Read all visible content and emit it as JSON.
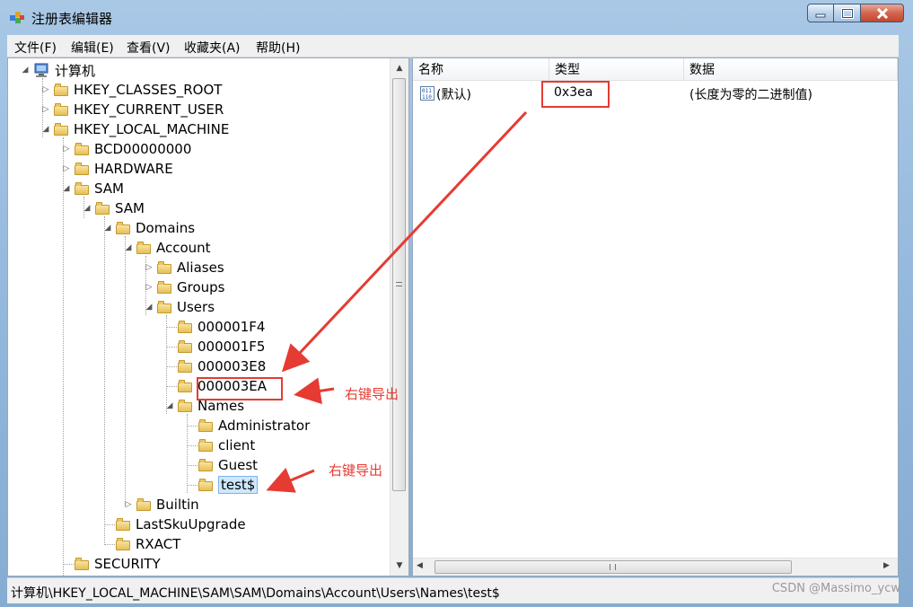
{
  "window": {
    "title": "注册表编辑器",
    "app_icon": "regedit-icon",
    "caption_buttons": [
      "minimize-icon",
      "maximize-icon",
      "close-icon"
    ]
  },
  "menu": [
    "文件(F)",
    "编辑(E)",
    "查看(V)",
    "收藏夹(A)",
    "帮助(H)"
  ],
  "tree": {
    "root": "计算机",
    "nodes": [
      {
        "label": "HKEY_CLASSES_ROOT",
        "expander": "collapsed"
      },
      {
        "label": "HKEY_CURRENT_USER",
        "expander": "collapsed"
      },
      {
        "label": "HKEY_LOCAL_MACHINE",
        "expander": "expanded"
      },
      {
        "label": "BCD00000000",
        "expander": "collapsed"
      },
      {
        "label": "HARDWARE",
        "expander": "collapsed"
      },
      {
        "label": "SAM",
        "expander": "expanded"
      },
      {
        "label": "SAM",
        "expander": "expanded"
      },
      {
        "label": "Domains",
        "expander": "expanded"
      },
      {
        "label": "Account",
        "expander": "expanded"
      },
      {
        "label": "Aliases",
        "expander": "collapsed"
      },
      {
        "label": "Groups",
        "expander": "collapsed"
      },
      {
        "label": "Users",
        "expander": "expanded"
      },
      {
        "label": "000001F4",
        "expander": "none"
      },
      {
        "label": "000001F5",
        "expander": "none"
      },
      {
        "label": "000003E8",
        "expander": "none"
      },
      {
        "label": "000003EA",
        "expander": "none"
      },
      {
        "label": "Names",
        "expander": "expanded"
      },
      {
        "label": "Administrator",
        "expander": "none"
      },
      {
        "label": "client",
        "expander": "none"
      },
      {
        "label": "Guest",
        "expander": "none"
      },
      {
        "label": "test$",
        "expander": "none",
        "selected": true
      },
      {
        "label": "Builtin",
        "expander": "collapsed"
      },
      {
        "label": "LastSkuUpgrade",
        "expander": "none"
      },
      {
        "label": "RXACT",
        "expander": "none"
      },
      {
        "label": "SECURITY",
        "expander": "none"
      }
    ]
  },
  "list": {
    "columns": [
      "名称",
      "类型",
      "数据"
    ],
    "rows": [
      {
        "name": "(默认)",
        "type": "0x3ea",
        "data": "(长度为零的二进制值)",
        "icon": "binary-value-icon"
      }
    ]
  },
  "status_path": "计算机\\HKEY_LOCAL_MACHINE\\SAM\\SAM\\Domains\\Account\\Users\\Names\\test$",
  "annotations": {
    "label_1": "右键导出",
    "label_2": "右键导出",
    "color": "#e63b32"
  },
  "watermark": "CSDN @Massimo_ycw"
}
